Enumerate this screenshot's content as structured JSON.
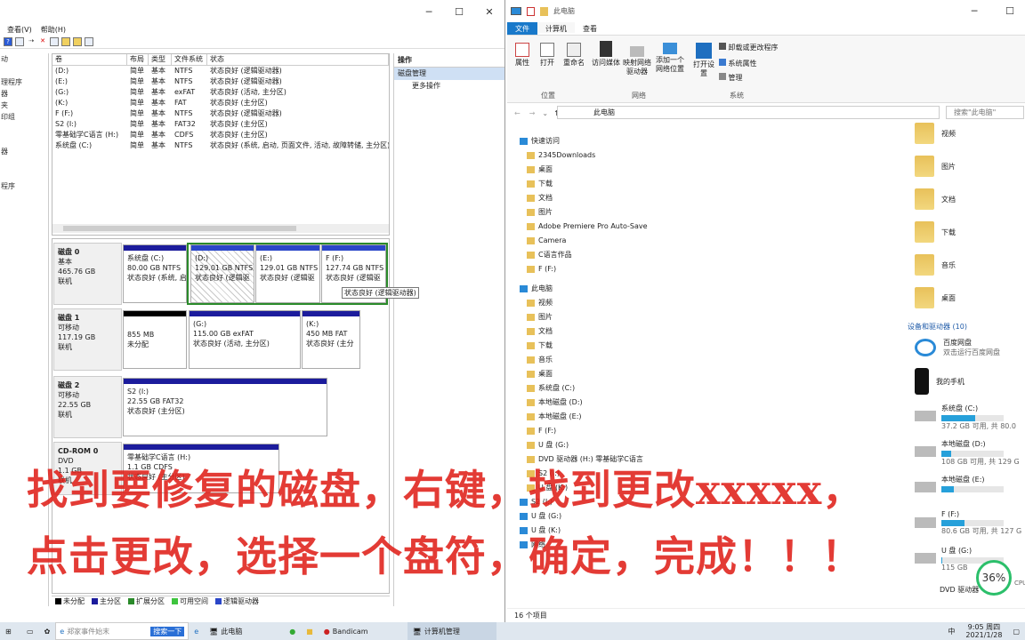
{
  "disk_mgmt": {
    "menu": [
      "查看(V)",
      "帮助(H)"
    ],
    "leftnav": [
      "动",
      "",
      "理程序",
      "器",
      "夹",
      "印组",
      "",
      "",
      "器",
      "",
      "",
      "程序"
    ],
    "vol_headers": [
      "卷",
      "布局",
      "类型",
      "文件系统",
      "状态"
    ],
    "volumes": [
      {
        "name": "(D:)",
        "layout": "简单",
        "type": "基本",
        "fs": "NTFS",
        "status": "状态良好 (逻辑驱动器)"
      },
      {
        "name": "(E:)",
        "layout": "简单",
        "type": "基本",
        "fs": "NTFS",
        "status": "状态良好 (逻辑驱动器)"
      },
      {
        "name": "(G:)",
        "layout": "简单",
        "type": "基本",
        "fs": "exFAT",
        "status": "状态良好 (活动, 主分区)"
      },
      {
        "name": "(K:)",
        "layout": "简单",
        "type": "基本",
        "fs": "FAT",
        "status": "状态良好 (主分区)"
      },
      {
        "name": "F (F:)",
        "layout": "简单",
        "type": "基本",
        "fs": "NTFS",
        "status": "状态良好 (逻辑驱动器)"
      },
      {
        "name": "S2 (I:)",
        "layout": "简单",
        "type": "基本",
        "fs": "FAT32",
        "status": "状态良好 (主分区)"
      },
      {
        "name": "零基础学C语言 (H:)",
        "layout": "简单",
        "type": "基本",
        "fs": "CDFS",
        "status": "状态良好 (主分区)"
      },
      {
        "name": "系统盘 (C:)",
        "layout": "简单",
        "type": "基本",
        "fs": "NTFS",
        "status": "状态良好 (系统, 启动, 页面文件, 活动, 故障转储, 主分区)"
      }
    ],
    "actions": {
      "title": "操作",
      "selected": "磁盘管理",
      "more": "更多操作"
    },
    "disks": [
      {
        "name": "磁盘 0",
        "type": "基本",
        "size": "465.76 GB",
        "state": "联机"
      },
      {
        "name": "磁盘 1",
        "type": "可移动",
        "size": "117.19 GB",
        "state": "联机"
      },
      {
        "name": "磁盘 2",
        "type": "可移动",
        "size": "22.55 GB",
        "state": "联机"
      },
      {
        "name": "CD-ROM 0",
        "type": "DVD",
        "size": "1.1 GB",
        "state": "联机"
      }
    ],
    "partitions": {
      "c": {
        "name": "系统盘 (C:)",
        "size": "80.00 GB NTFS",
        "status": "状态良好 (系统, 启"
      },
      "d": {
        "name": "(D:)",
        "size": "129.01 GB NTFS",
        "status": "状态良好 (逻辑驱"
      },
      "e": {
        "name": "(E:)",
        "size": "129.01 GB NTFS",
        "status": "状态良好 (逻辑驱"
      },
      "f": {
        "name": "F (F:)",
        "size": "127.74 GB NTFS",
        "status": "状态良好 (逻辑驱"
      },
      "f_tip": "状态良好 (逻辑驱动器)",
      "u1": {
        "size": "855 MB",
        "status": "未分配"
      },
      "g": {
        "name": "(G:)",
        "size": "115.00 GB exFAT",
        "status": "状态良好 (活动, 主分区)"
      },
      "k": {
        "name": "(K:)",
        "size": "450 MB FAT",
        "status": "状态良好 (主分"
      },
      "i": {
        "name": "S2 (I:)",
        "size": "22.55 GB FAT32",
        "status": "状态良好 (主分区)"
      },
      "h": {
        "name": "零基础学C语言 (H:)",
        "size": "1.1 GB CDFS",
        "status": "状态良好 (主分区)"
      }
    },
    "legend": [
      "未分配",
      "主分区",
      "扩展分区",
      "可用空间",
      "逻辑驱动器"
    ],
    "legend_colors": [
      "#000000",
      "#1c1c9c",
      "#2a8a2a",
      "#3ec43e",
      "#2a46c8"
    ]
  },
  "explorer": {
    "title": "此电脑",
    "tabs": [
      "文件",
      "计算机",
      "查看"
    ],
    "ribbon": {
      "props": "属性",
      "open": "打开",
      "rename": "重命名",
      "media": "访问媒体",
      "map": "映射网络驱动器",
      "add": "添加一个网络位置",
      "settings": "打开设置",
      "uninstall": "卸载或更改程序",
      "sysprops": "系统属性",
      "manage": "管理",
      "groups": [
        "位置",
        "网络",
        "系统"
      ]
    },
    "address": "此电脑",
    "search": "搜索\"此电脑\"",
    "nav": [
      {
        "label": "快速访问",
        "indent": 0
      },
      {
        "label": "2345Downloads",
        "indent": 1
      },
      {
        "label": "桌面",
        "indent": 1
      },
      {
        "label": "下载",
        "indent": 1
      },
      {
        "label": "文档",
        "indent": 1
      },
      {
        "label": "图片",
        "indent": 1
      },
      {
        "label": "Adobe Premiere Pro Auto-Save",
        "indent": 1
      },
      {
        "label": "Camera",
        "indent": 1
      },
      {
        "label": "C语言作品",
        "indent": 1
      },
      {
        "label": "F (F:)",
        "indent": 1
      },
      {
        "label": "此电脑",
        "indent": 0
      },
      {
        "label": "视频",
        "indent": 1
      },
      {
        "label": "图片",
        "indent": 1
      },
      {
        "label": "文档",
        "indent": 1
      },
      {
        "label": "下载",
        "indent": 1
      },
      {
        "label": "音乐",
        "indent": 1
      },
      {
        "label": "桌面",
        "indent": 1
      },
      {
        "label": "系统盘 (C:)",
        "indent": 1
      },
      {
        "label": "本地磁盘 (D:)",
        "indent": 1
      },
      {
        "label": "本地磁盘 (E:)",
        "indent": 1
      },
      {
        "label": "F (F:)",
        "indent": 1
      },
      {
        "label": "U 盘 (G:)",
        "indent": 1
      },
      {
        "label": "DVD 驱动器 (H:) 零基础学C语言",
        "indent": 1
      },
      {
        "label": "S2 (I:)",
        "indent": 1
      },
      {
        "label": "U 盘 (K:)",
        "indent": 1
      },
      {
        "label": "S2 (I:)",
        "indent": 0
      },
      {
        "label": "U 盘 (G:)",
        "indent": 0
      },
      {
        "label": "U 盘 (K:)",
        "indent": 0
      },
      {
        "label": "网络",
        "indent": 0
      }
    ],
    "folders": [
      "视频",
      "图片",
      "文档",
      "下载",
      "音乐",
      "桌面"
    ],
    "devices_header": "设备和驱动器 (10)",
    "baidu": {
      "name": "百度网盘",
      "sub": "双击运行百度网盘"
    },
    "phone": "我的手机",
    "drives": [
      {
        "name": "系统盘 (C:)",
        "free": "37.2 GB 可用, 共 80.0",
        "fill": 0.54
      },
      {
        "name": "本地磁盘 (D:)",
        "free": "108 GB 可用, 共 129 G",
        "fill": 0.16
      },
      {
        "name": "本地磁盘 (E:)",
        "free": "",
        "fill": 0.2
      },
      {
        "name": "F (F:)",
        "free": "80.6 GB 可用, 共 127 G",
        "fill": 0.37
      },
      {
        "name": "U 盘 (G:)",
        "free": "115 GB",
        "fill": 0.02
      }
    ],
    "dvd": "DVD 驱动器",
    "status": "16 个项目"
  },
  "overlay": {
    "line1": "找到要修复的磁盘，右键，找到更改xxxxx，",
    "line2": "点击更改，选择一个盘符，确定，完成！！！"
  },
  "gauge": {
    "value": "36%",
    "sub": "CPU"
  },
  "taskbar": {
    "search": "搜索一下",
    "search_hint": "郑家事件始末",
    "apps": [
      "此电脑",
      "Bandicam",
      "计算机管理"
    ],
    "ime": "中",
    "time": "9:05 周四",
    "date": "2021/1/28"
  }
}
